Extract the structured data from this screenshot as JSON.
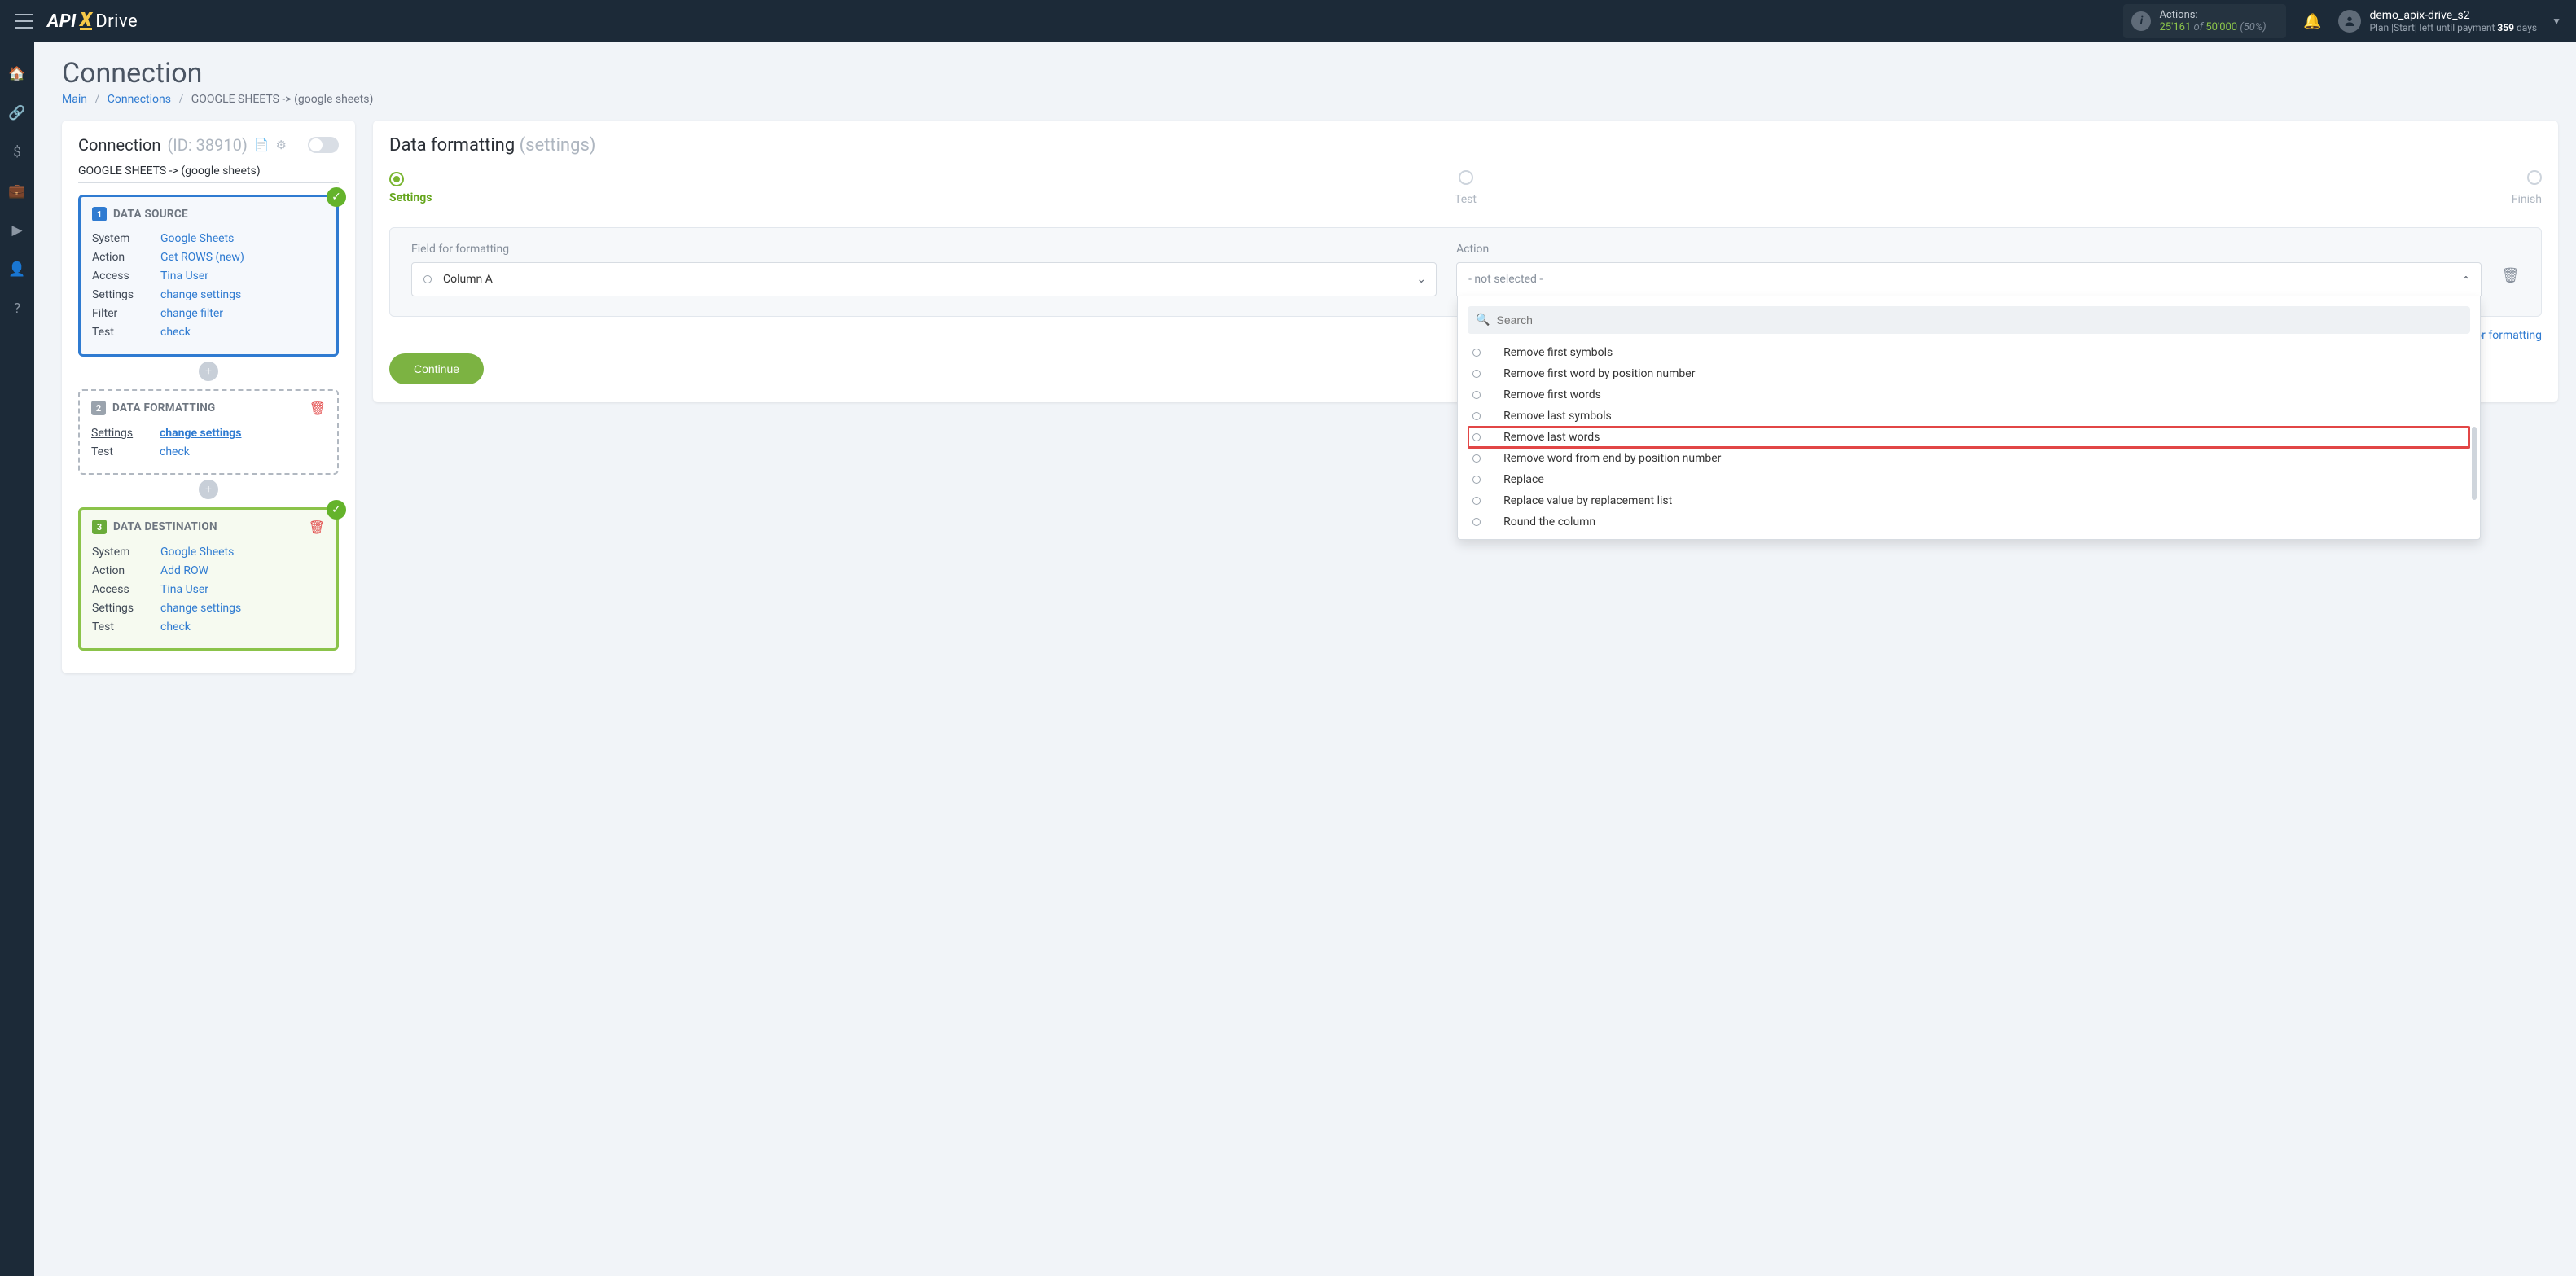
{
  "topbar": {
    "logo": {
      "api": "API",
      "x": "X",
      "drive": "Drive"
    },
    "actions_box": {
      "label": "Actions:",
      "used": "25'161",
      "of": "of",
      "total": "50'000",
      "pct": "(50%)"
    },
    "user": {
      "name": "demo_apix-drive_s2",
      "plan_prefix": "Plan |Start| left until payment ",
      "days": "359",
      "plan_suffix": " days"
    }
  },
  "sidenav": {
    "items": [
      {
        "name": "home-icon",
        "glyph": "🏠"
      },
      {
        "name": "sitemap-icon",
        "glyph": "🔗"
      },
      {
        "name": "dollar-icon",
        "glyph": "$"
      },
      {
        "name": "briefcase-icon",
        "glyph": "💼"
      },
      {
        "name": "youtube-icon",
        "glyph": "▶"
      },
      {
        "name": "user-icon",
        "glyph": "👤"
      },
      {
        "name": "help-icon",
        "glyph": "?"
      }
    ]
  },
  "page": {
    "title": "Connection",
    "breadcrumb": {
      "main": "Main",
      "connections": "Connections",
      "current": "GOOGLE SHEETS -> (google sheets)"
    }
  },
  "left": {
    "header": {
      "title": "Connection",
      "id": "(ID: 38910)"
    },
    "conn_name": "GOOGLE SHEETS -> (google sheets)",
    "source": {
      "title": "DATA SOURCE",
      "rows": [
        {
          "k": "System",
          "v": "Google Sheets"
        },
        {
          "k": "Action",
          "v": "Get ROWS (new)"
        },
        {
          "k": "Access",
          "v": "Tina User"
        },
        {
          "k": "Settings",
          "v": "change settings"
        },
        {
          "k": "Filter",
          "v": "change filter"
        },
        {
          "k": "Test",
          "v": "check"
        }
      ]
    },
    "format": {
      "title": "DATA FORMATTING",
      "rows": [
        {
          "k": "Settings",
          "v": "change settings"
        },
        {
          "k": "Test",
          "v": "check"
        }
      ]
    },
    "dest": {
      "title": "DATA DESTINATION",
      "rows": [
        {
          "k": "System",
          "v": "Google Sheets"
        },
        {
          "k": "Action",
          "v": "Add ROW"
        },
        {
          "k": "Access",
          "v": "Tina User"
        },
        {
          "k": "Settings",
          "v": "change settings"
        },
        {
          "k": "Test",
          "v": "check"
        }
      ]
    }
  },
  "right": {
    "title_main": "Data formatting ",
    "title_grey": "(settings)",
    "steps": [
      {
        "label": "Settings",
        "active": true
      },
      {
        "label": "Test",
        "active": false
      },
      {
        "label": "Finish",
        "active": false
      }
    ],
    "field_label": "Field for formatting",
    "field_value": "Column A",
    "action_label": "Action",
    "action_value": "- not selected -",
    "search_placeholder": "Search",
    "dropdown_options": [
      "Remove first symbols",
      "Remove first word by position number",
      "Remove first words",
      "Remove last symbols",
      "Remove last words",
      "Remove word from end by position number",
      "Replace",
      "Replace value by replacement list",
      "Round the column"
    ],
    "dropdown_highlight_index": 4,
    "add_link": "+ Add field for formatting",
    "continue": "Continue"
  }
}
